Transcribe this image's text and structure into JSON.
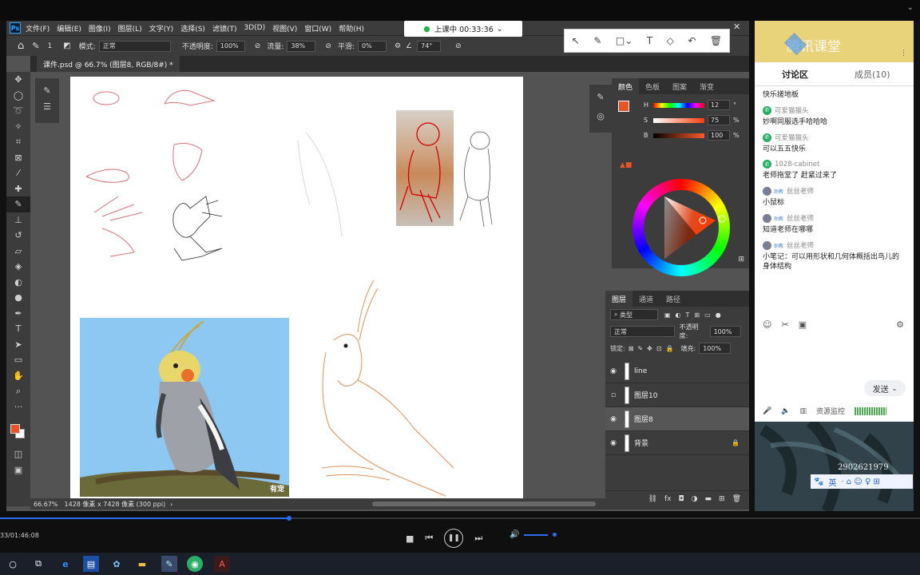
{
  "photoshop": {
    "menu": [
      "文件(F)",
      "编辑(E)",
      "图像(I)",
      "图层(L)",
      "文字(Y)",
      "选择(S)",
      "滤镜(T)",
      "3D(D)",
      "视图(V)",
      "窗口(W)",
      "帮助(H)"
    ],
    "options": {
      "mode_label": "模式:",
      "mode_value": "正常",
      "opacity_label": "不透明度:",
      "opacity_value": "100%",
      "flow_label": "流量:",
      "flow_value": "38%",
      "smooth_label": "平滑:",
      "smooth_value": "0%",
      "angle_value": "74°",
      "brush_size": "1"
    },
    "document_tab": "课件.psd @ 66.7% (图层8, RGB/8#) *",
    "status": {
      "zoom": "66.67%",
      "doc_info": "1428 像素 x 7428 像素 (300 ppi)"
    },
    "canvas_watermark": "有宠",
    "color_panel": {
      "tabs": [
        "颜色",
        "色板",
        "图案",
        "渐变"
      ],
      "h_label": "H",
      "h_value": "12",
      "h_unit": "°",
      "s_label": "S",
      "s_value": "75",
      "s_unit": "%",
      "b_label": "B",
      "b_value": "100",
      "b_unit": "%",
      "foreground": "#e8542a"
    },
    "layers_panel": {
      "tabs": [
        "图层",
        "通道",
        "路径"
      ],
      "kind_filter": "类型",
      "blend_mode": "正常",
      "opacity_label": "不透明度:",
      "opacity_value": "100%",
      "lock_label": "锁定:",
      "fill_label": "填充:",
      "fill_value": "100%",
      "layers": [
        {
          "name": "line",
          "visible": true,
          "selected": false
        },
        {
          "name": "图层10",
          "visible": false,
          "selected": false
        },
        {
          "name": "图层8",
          "visible": true,
          "selected": true
        },
        {
          "name": "背景",
          "visible": true,
          "selected": false,
          "locked": true
        }
      ]
    }
  },
  "live_status": "上课中 00:33:36",
  "chat": {
    "header_logo": "腾讯课堂",
    "tab_discussion": "讨论区",
    "tab_members": "成员(10)",
    "messages": [
      {
        "user": "",
        "text": "快乐搓地板",
        "icon": "none"
      },
      {
        "user": "可爱猫猫头",
        "text": "妙啊同服选手哈哈哈",
        "icon": "wechat"
      },
      {
        "user": "可爱猫猫头",
        "text": "可以五五快乐",
        "icon": "wechat"
      },
      {
        "user": "1028-cabinet",
        "text": "老师拖堂了 赶紧过来了",
        "icon": "wechat"
      },
      {
        "user": "丝丝老师",
        "text": "小鼠标",
        "icon": "avatar",
        "badge": "助教"
      },
      {
        "user": "丝丝老师",
        "text": "知道老师在哪哪",
        "icon": "avatar",
        "badge": "助教"
      },
      {
        "user": "丝丝老师",
        "text": "小笔记：可以用形状和几何体概括出鸟儿的身体结构",
        "icon": "avatar",
        "badge": "助教"
      }
    ],
    "send_label": "发送",
    "monitor_label": "资源监控"
  },
  "video": {
    "overlay_number": "2902621979",
    "ime_label": "英"
  },
  "player": {
    "time": "33/01:46:08",
    "progress": 0.314
  }
}
